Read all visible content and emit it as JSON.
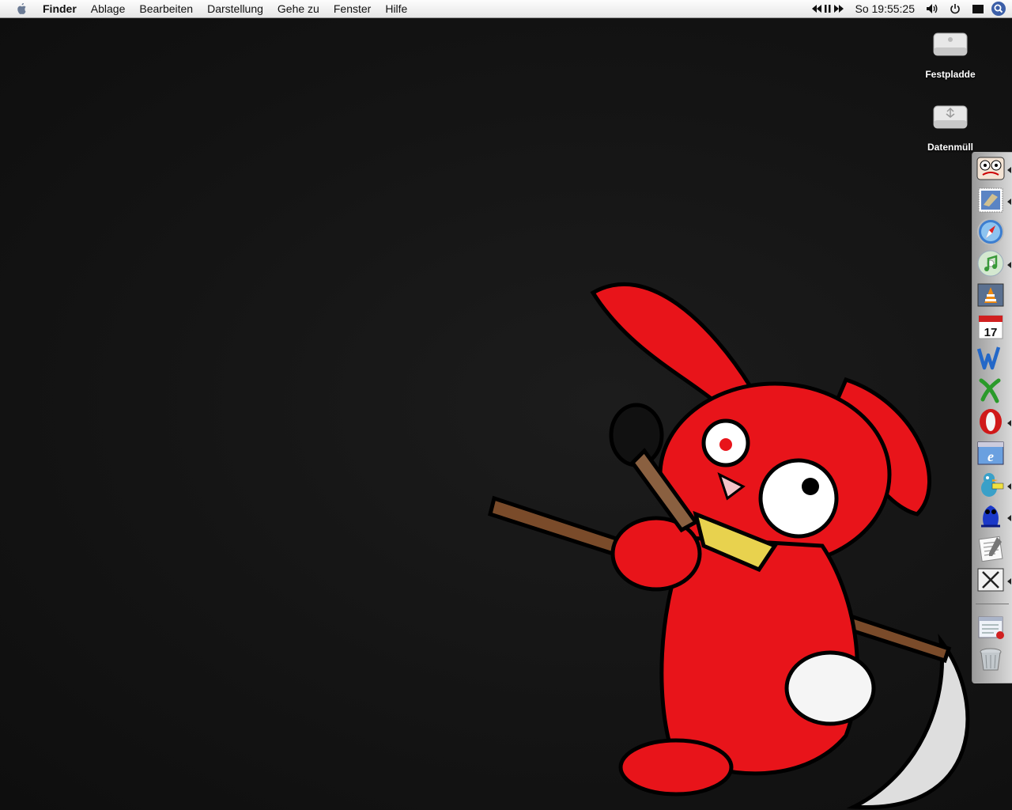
{
  "menubar": {
    "app_name": "Finder",
    "items": [
      "Ablage",
      "Bearbeiten",
      "Darstellung",
      "Gehe zu",
      "Fenster",
      "Hilfe"
    ],
    "clock": "So 19:55:25",
    "icons": [
      "apple-icon",
      "media-controls-icon",
      "volume-icon",
      "power-icon",
      "display-icon",
      "spotlight-icon"
    ]
  },
  "desktop": {
    "icons": [
      {
        "label": "Festpladde",
        "icon": "hard-drive-icon"
      },
      {
        "label": "Datenmüll",
        "icon": "usb-drive-icon"
      }
    ],
    "wallpaper": "red-rabbit-with-scythe"
  },
  "dock": {
    "items": [
      {
        "name": "cartoon-face-app",
        "icon": "cartoon-face-icon",
        "running": true
      },
      {
        "name": "mail",
        "icon": "mail-stamp-icon",
        "running": true
      },
      {
        "name": "safari",
        "icon": "compass-icon",
        "running": false
      },
      {
        "name": "itunes",
        "icon": "music-cd-icon",
        "running": true
      },
      {
        "name": "vlc",
        "icon": "traffic-cone-icon",
        "running": false
      },
      {
        "name": "ical",
        "icon": "calendar-icon",
        "running": false,
        "text": "17"
      },
      {
        "name": "word",
        "icon": "word-w-icon",
        "running": false
      },
      {
        "name": "excel",
        "icon": "excel-x-icon",
        "running": false
      },
      {
        "name": "opera",
        "icon": "opera-o-icon",
        "running": true
      },
      {
        "name": "internet-explorer",
        "icon": "ie-browser-icon",
        "running": false
      },
      {
        "name": "adium",
        "icon": "duck-icon",
        "running": true
      },
      {
        "name": "bluetooth-frog",
        "icon": "blue-frog-icon",
        "running": true
      },
      {
        "name": "textedit",
        "icon": "text-document-icon",
        "running": false
      },
      {
        "name": "x11",
        "icon": "x11-icon",
        "running": true
      },
      {
        "name": "downloads",
        "icon": "downloads-window-icon",
        "running": false
      },
      {
        "name": "trash",
        "icon": "trash-icon",
        "running": false
      }
    ]
  },
  "colors": {
    "rabbit_red": "#e8141a",
    "desktop_bg": "#141414"
  }
}
